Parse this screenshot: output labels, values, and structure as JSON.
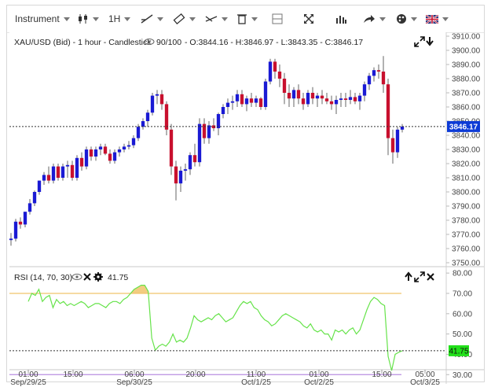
{
  "toolbar": {
    "instrument_label": "Instrument",
    "timeframe_label": "1H",
    "icons": [
      "candlestick-type-icon",
      "trendline-icon",
      "ruler-icon",
      "line-tools-icon",
      "trash-icon",
      "layout-icon",
      "fullscreen-icon",
      "indicators-icon",
      "share-icon",
      "theme-icon",
      "uk-flag-icon"
    ]
  },
  "main_header": {
    "symbol": "XAU/USD (Bid) - 1 hour - Candlestick",
    "score": "90/100",
    "ohlc": "- O:3844.16 - H:3846.97 - L:3843.35 - C:3846.17"
  },
  "price_axis": {
    "ticks": [
      "3910.00",
      "3900.00",
      "3890.00",
      "3880.00",
      "3870.00",
      "3860.00",
      "3850.00",
      "3840.00",
      "3830.00",
      "3820.00",
      "3810.00",
      "3800.00",
      "3790.00",
      "3780.00",
      "3770.00",
      "3760.00",
      "3750.00"
    ],
    "current_price": "3846.17",
    "current_color": "#0d3bd6"
  },
  "rsi": {
    "label": "RSI (14, 70, 30)",
    "value": "41.75",
    "ticks": [
      "80.00",
      "70.00",
      "60.00",
      "50.00",
      "40.00",
      "30.00"
    ],
    "line_color": "#66e34a",
    "upper_color": "#f0c36b",
    "lower_color": "#b98ee0",
    "value_bg": "#22e01a"
  },
  "time_axis": {
    "ticks": [
      "01:00",
      "15:00",
      "06:00",
      "20:00",
      "11:00",
      "01:00",
      "15:00",
      "05:00"
    ],
    "dates": [
      "Sep/29/25",
      "Sep/30/25",
      "Oct/1/25",
      "Oct/2/25",
      "Oct/3/25"
    ]
  },
  "chart_data": [
    {
      "type": "candlestick",
      "title": "XAU/USD (Bid) - 1 hour - Candlestick",
      "ylim": [
        3750,
        3910
      ],
      "colors": {
        "up": "#1a1ad4",
        "down": "#c8102e"
      },
      "candles": [
        [
          3766,
          3771,
          3762,
          3767
        ],
        [
          3767,
          3781,
          3765,
          3779
        ],
        [
          3779,
          3782,
          3774,
          3777
        ],
        [
          3777,
          3786,
          3775,
          3786
        ],
        [
          3786,
          3795,
          3784,
          3792
        ],
        [
          3792,
          3801,
          3790,
          3800
        ],
        [
          3800,
          3808,
          3798,
          3808
        ],
        [
          3808,
          3814,
          3805,
          3812
        ],
        [
          3812,
          3818,
          3806,
          3808
        ],
        [
          3808,
          3820,
          3806,
          3818
        ],
        [
          3818,
          3820,
          3808,
          3810
        ],
        [
          3810,
          3820,
          3808,
          3818
        ],
        [
          3818,
          3822,
          3810,
          3819
        ],
        [
          3819,
          3822,
          3808,
          3810
        ],
        [
          3810,
          3826,
          3808,
          3824
        ],
        [
          3824,
          3828,
          3815,
          3818
        ],
        [
          3818,
          3832,
          3816,
          3830
        ],
        [
          3830,
          3832,
          3822,
          3825
        ],
        [
          3825,
          3832,
          3822,
          3830
        ],
        [
          3830,
          3834,
          3826,
          3832
        ],
        [
          3832,
          3834,
          3826,
          3827
        ],
        [
          3827,
          3830,
          3820,
          3822
        ],
        [
          3822,
          3830,
          3820,
          3828
        ],
        [
          3828,
          3832,
          3825,
          3830
        ],
        [
          3830,
          3834,
          3828,
          3832
        ],
        [
          3832,
          3836,
          3830,
          3833
        ],
        [
          3833,
          3840,
          3831,
          3838
        ],
        [
          3838,
          3848,
          3836,
          3846
        ],
        [
          3846,
          3852,
          3844,
          3850
        ],
        [
          3850,
          3858,
          3846,
          3856
        ],
        [
          3856,
          3870,
          3854,
          3868
        ],
        [
          3868,
          3872,
          3862,
          3869
        ],
        [
          3869,
          3872,
          3858,
          3862
        ],
        [
          3862,
          3864,
          3840,
          3844
        ],
        [
          3844,
          3848,
          3812,
          3818
        ],
        [
          3818,
          3822,
          3794,
          3806
        ],
        [
          3806,
          3818,
          3800,
          3815
        ],
        [
          3815,
          3820,
          3808,
          3816
        ],
        [
          3816,
          3828,
          3812,
          3826
        ],
        [
          3826,
          3834,
          3818,
          3821
        ],
        [
          3821,
          3852,
          3818,
          3848
        ],
        [
          3848,
          3852,
          3834,
          3838
        ],
        [
          3838,
          3850,
          3834,
          3847
        ],
        [
          3847,
          3852,
          3843,
          3845
        ],
        [
          3845,
          3856,
          3840,
          3855
        ],
        [
          3855,
          3862,
          3852,
          3860
        ],
        [
          3860,
          3866,
          3855,
          3863
        ],
        [
          3863,
          3868,
          3858,
          3864
        ],
        [
          3864,
          3872,
          3860,
          3869
        ],
        [
          3869,
          3872,
          3860,
          3862
        ],
        [
          3862,
          3868,
          3857,
          3866
        ],
        [
          3866,
          3870,
          3860,
          3863
        ],
        [
          3863,
          3868,
          3860,
          3866
        ],
        [
          3866,
          3867,
          3858,
          3860
        ],
        [
          3860,
          3880,
          3858,
          3878
        ],
        [
          3878,
          3894,
          3876,
          3892
        ],
        [
          3892,
          3894,
          3880,
          3885
        ],
        [
          3885,
          3890,
          3874,
          3880
        ],
        [
          3880,
          3884,
          3862,
          3870
        ],
        [
          3870,
          3876,
          3860,
          3866
        ],
        [
          3866,
          3874,
          3860,
          3872
        ],
        [
          3872,
          3876,
          3862,
          3866
        ],
        [
          3866,
          3870,
          3858,
          3862
        ],
        [
          3862,
          3872,
          3860,
          3870
        ],
        [
          3870,
          3874,
          3862,
          3866
        ],
        [
          3866,
          3870,
          3860,
          3868
        ],
        [
          3868,
          3872,
          3862,
          3866
        ],
        [
          3866,
          3870,
          3862,
          3864
        ],
        [
          3864,
          3868,
          3858,
          3862
        ],
        [
          3862,
          3868,
          3855,
          3865
        ],
        [
          3865,
          3870,
          3860,
          3866
        ],
        [
          3866,
          3870,
          3860,
          3865
        ],
        [
          3865,
          3872,
          3862,
          3867
        ],
        [
          3867,
          3870,
          3862,
          3864
        ],
        [
          3864,
          3870,
          3858,
          3868
        ],
        [
          3868,
          3878,
          3864,
          3876
        ],
        [
          3876,
          3884,
          3872,
          3882
        ],
        [
          3882,
          3888,
          3878,
          3886
        ],
        [
          3886,
          3890,
          3880,
          3885
        ],
        [
          3885,
          3896,
          3870,
          3876
        ],
        [
          3876,
          3880,
          3826,
          3838
        ],
        [
          3838,
          3844,
          3820,
          3828
        ],
        [
          3828,
          3846,
          3824,
          3844
        ],
        [
          3844,
          3848,
          3842,
          3846.17
        ]
      ]
    },
    {
      "type": "line",
      "title": "RSI (14, 70, 30)",
      "ylim": [
        27,
        82
      ],
      "thresholds": [
        70,
        30
      ],
      "values": [
        66,
        70,
        69,
        72,
        66,
        68,
        69,
        63,
        67,
        65,
        66,
        64,
        65,
        64,
        65,
        66,
        65,
        63,
        64,
        65,
        65,
        64,
        63,
        65,
        66,
        66,
        65,
        67,
        68,
        70,
        72,
        73,
        74,
        74,
        71,
        48,
        42,
        44,
        45,
        44,
        46,
        50,
        46,
        47,
        46,
        48,
        53,
        59,
        57,
        56,
        57,
        58,
        57,
        59,
        60,
        58,
        56,
        57,
        58,
        61,
        64,
        66,
        65,
        66,
        63,
        62,
        59,
        57,
        56,
        54,
        55,
        57,
        59,
        60,
        59,
        58,
        57,
        56,
        54,
        53,
        55,
        52,
        51,
        52,
        50,
        50,
        47,
        52,
        51,
        52,
        50,
        52,
        53,
        50,
        52,
        57,
        62,
        66,
        68,
        67,
        65,
        64,
        39,
        32,
        40,
        41,
        41.75
      ]
    }
  ]
}
